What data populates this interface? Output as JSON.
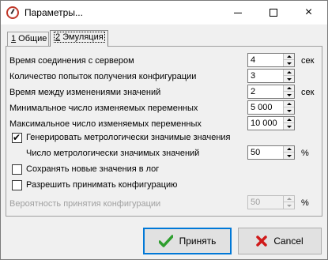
{
  "window": {
    "title": "Параметры...",
    "controls": {
      "minimize": "minimize",
      "maximize": "maximize",
      "close": "×"
    }
  },
  "tabs": [
    {
      "number": "1",
      "label": " Общие",
      "active": false
    },
    {
      "number": "2",
      "label": " Эмуляция",
      "active": true
    }
  ],
  "settings": {
    "connection_time": {
      "label": "Время соединения с сервером",
      "value": "4",
      "unit": "сек"
    },
    "config_attempts": {
      "label": "Количество попыток получения конфигурации",
      "value": "3"
    },
    "time_between": {
      "label": "Время между изменениями значений",
      "value": "2",
      "unit": "сек"
    },
    "min_vars": {
      "label": "Минимальное число изменяемых переменных",
      "value": "5 000"
    },
    "max_vars": {
      "label": "Максимальное число изменяемых переменных",
      "value": "10 000"
    },
    "gen_metro": {
      "label": "Генерировать метрологически значимые значения",
      "checked": true
    },
    "metro_count": {
      "label": "Число метрологически значимых значений",
      "value": "50",
      "unit": "%"
    },
    "save_log": {
      "label": "Сохранять новые значения в лог",
      "checked": false
    },
    "allow_config": {
      "label": "Разрешить принимать конфигурацию",
      "checked": false
    },
    "config_prob": {
      "label": "Вероятность принятия конфигурации",
      "value": "50",
      "unit": "%",
      "disabled": true
    }
  },
  "buttons": {
    "ok": "Принять",
    "cancel": "Cancel"
  },
  "colors": {
    "accent": "#0078d7",
    "ok_icon": "#2e9e2e",
    "cancel_icon": "#d01a1a",
    "disabled_text": "#a0a0a0"
  },
  "icons": {
    "app": "gauge-icon",
    "ok": "checkmark-icon",
    "cancel": "x-icon"
  }
}
